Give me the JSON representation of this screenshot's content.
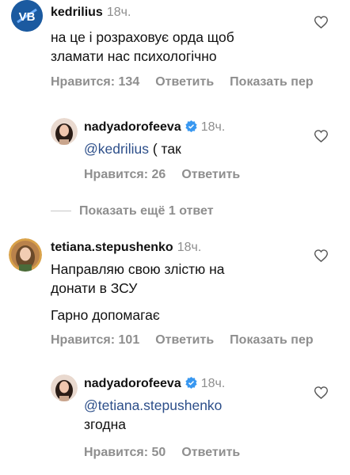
{
  "comments": [
    {
      "username": "kedrilius",
      "time": "18ч.",
      "avatar_text": "VB",
      "lines": [
        "на це і розраховує орда щоб",
        "зламати нас психологічно"
      ],
      "likes": "Нравится: 134",
      "reply": "Ответить",
      "translate": "Показать пер"
    },
    {
      "username": "nadyadorofeeva",
      "time": "18ч.",
      "mention": "@kedrilius",
      "text_after": " ( так",
      "likes": "Нравится: 26",
      "reply": "Ответить"
    },
    {
      "username": "tetiana.stepushenko",
      "time": "18ч.",
      "lines": [
        "Направляю свою злістю на",
        "донати в ЗСУ"
      ],
      "extra_line": "Гарно допомагає",
      "likes": "Нравится: 101",
      "reply": "Ответить",
      "translate": "Показать пер"
    },
    {
      "username": "nadyadorofeeva",
      "time": "18ч.",
      "mention": "@tetiana.stepushenko",
      "line2": "згодна",
      "likes": "Нравится: 50",
      "reply": "Ответить"
    }
  ],
  "show_more_replies": "Показать ещё 1 ответ",
  "colors": {
    "accent_link": "#2d4f8a",
    "muted": "#8e8e8e",
    "verified": "#3897f0"
  }
}
